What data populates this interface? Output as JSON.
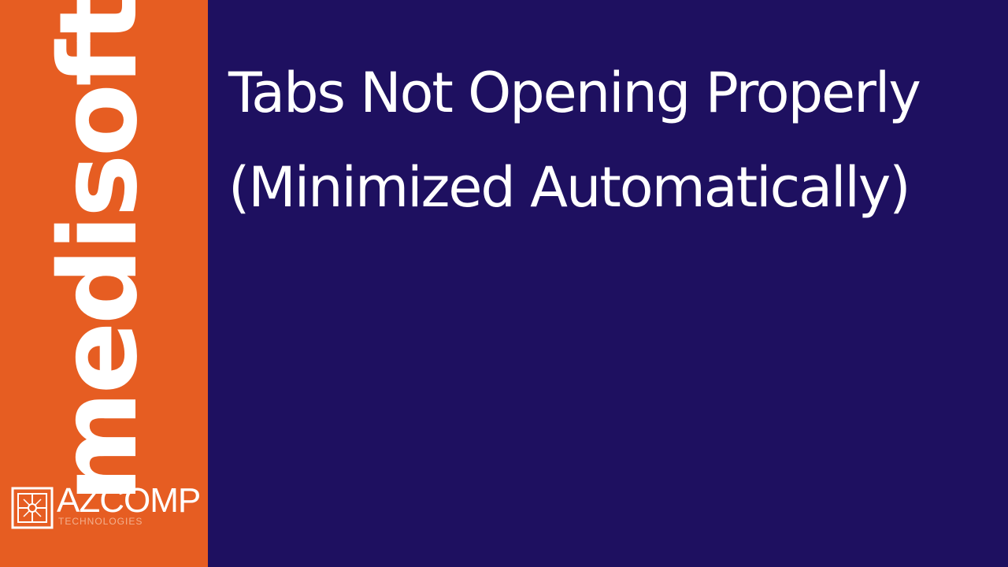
{
  "sidebar": {
    "brand_word": "medisoft",
    "background_color": "#e65d22",
    "logo": {
      "icon": "azcomp-logo-mark-icon",
      "name": "AZCOMP",
      "tagline": "TECHNOLOGIES"
    }
  },
  "main": {
    "background_color": "#1e1060",
    "title_line_1": "Tabs Not Opening Properly",
    "title_line_2": "(Minimized Automatically)"
  }
}
